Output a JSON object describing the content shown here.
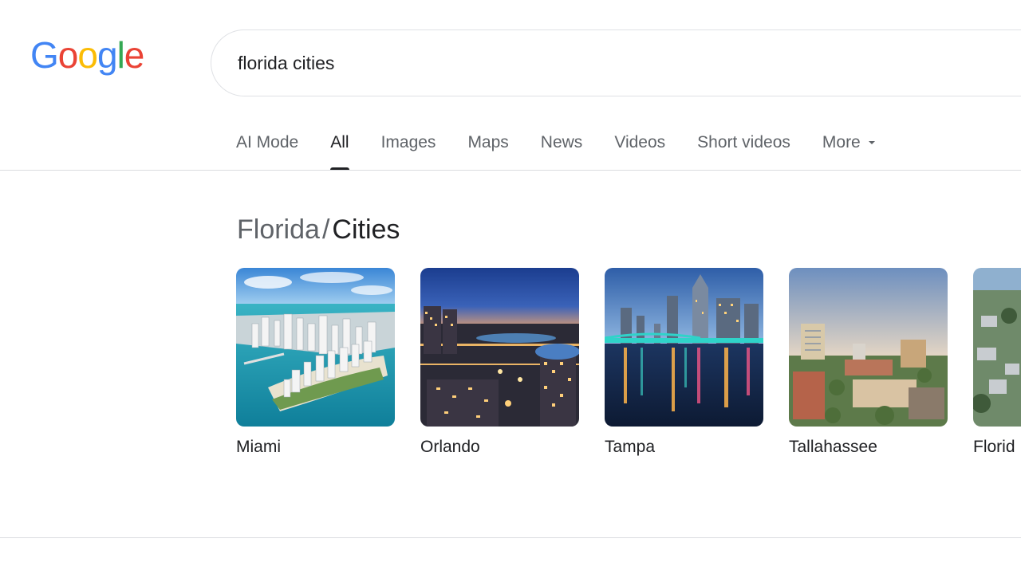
{
  "logo": {
    "letters": [
      "G",
      "o",
      "o",
      "g",
      "l",
      "e"
    ]
  },
  "search": {
    "query": "florida cities"
  },
  "tabs": [
    {
      "label": "AI Mode"
    },
    {
      "label": "All"
    },
    {
      "label": "Images"
    },
    {
      "label": "Maps"
    },
    {
      "label": "News"
    },
    {
      "label": "Videos"
    },
    {
      "label": "Short videos"
    },
    {
      "label": "More"
    }
  ],
  "breadcrumb": {
    "parent": "Florida",
    "separator": "/",
    "current": "Cities"
  },
  "cities": [
    {
      "name": "Miami",
      "image": "aerial-island-skyline"
    },
    {
      "name": "Orlando",
      "image": "dusk-city-lights"
    },
    {
      "name": "Tampa",
      "image": "night-skyline-river"
    },
    {
      "name": "Tallahassee",
      "image": "daytime-downtown"
    },
    {
      "name": "Florid",
      "image": "aerial-suburb"
    }
  ],
  "colors": {
    "google_blue": "#4285F4",
    "google_red": "#EA4335",
    "google_yellow": "#FBBC05",
    "google_green": "#34A853",
    "tab_inactive": "#5f6368",
    "tab_active": "#202124",
    "divider": "#dadce0"
  }
}
